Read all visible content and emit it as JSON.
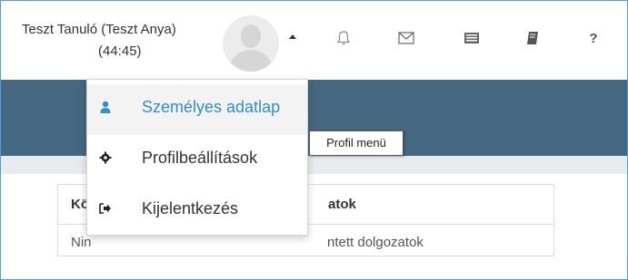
{
  "header": {
    "user_name": "Teszt Tanuló (Teszt Anya)",
    "session_timer": "(44:45)",
    "icons": [
      "avatar",
      "caret-up-icon",
      "bell-icon",
      "mail-icon",
      "card-icon",
      "book-icon",
      "help-icon"
    ],
    "help_label": "?"
  },
  "dropdown": {
    "items": [
      {
        "label": "Személyes adatlap",
        "icon": "user-icon",
        "active": true
      },
      {
        "label": "Profilbeállítások",
        "icon": "gear-icon",
        "active": false
      },
      {
        "label": "Kijelentkezés",
        "icon": "logout-icon",
        "active": false
      }
    ]
  },
  "tooltip": {
    "text": "Profil menü"
  },
  "panel": {
    "header_visible": "Kö",
    "header_visible_end": "atok",
    "body_visible_start": "Nin",
    "body_visible_end": "ntett dolgozatok"
  },
  "colors": {
    "accent": "#2f8fd0",
    "band": "#45677f",
    "frame": "#4aa3df"
  }
}
